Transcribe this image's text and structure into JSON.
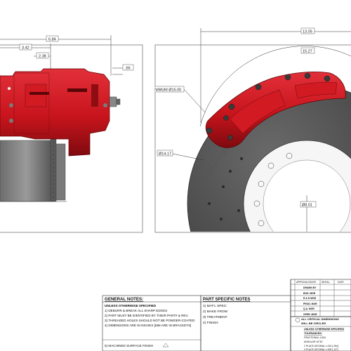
{
  "left_view": {
    "dim_top": "6.84",
    "dim_mid": "3.42",
    "dim_low": "2.38",
    "dim_bolt": ".66"
  },
  "right_view": {
    "dim_overall": "13.05",
    "dim_arc": "15.27",
    "dim_min_label": "MINIMUM Ø16.00",
    "dim_rotor": "Ø14.17",
    "dim_hub": "Ø8.01"
  },
  "general_notes": {
    "title": "GENERAL NOTES:",
    "subtitle": "UNLESS OTHERWISE SPECIFIED",
    "items": [
      "1) DEBURR & BREAK ALL SHARP EDGES",
      "2) PART MUST BE IDENTIFIED BY THEIR PART# & REV.",
      "3) THREADED HOLES SHOULD NOT BE POWDER-COATED",
      "4) DIMENSIONS ARE IN INCHES [MM ARE IN BRACKETS]",
      "5) MACHINED SURFACE FINISH"
    ]
  },
  "part_notes": {
    "title": "PART SPECIFIC NOTES",
    "items": [
      "1) MAT'L SPEC:",
      "2) MAKE FROM:",
      "3) TREATMENT:",
      "4) FINISH:"
    ]
  },
  "title_block": {
    "header_a": "APPROVALS/DATE",
    "header_b": "INITIAL",
    "header_c": "DATE",
    "rows": [
      "DRAWN BY",
      "ENG. MGR",
      "R & D MGR",
      "PROD. MGR",
      "Q.A. MGR",
      "OPER. MGR"
    ],
    "critical_1": "ALL CRITICAL DIMENSIONS",
    "critical_2": "WILL BE CIRCLED",
    "tol_title": "UNLESS OTHERWISE SPECIFIED",
    "tol_sub": "TOLERANCES:",
    "tol_items": [
      "FRACTIONAL ±1/64",
      "ANGULAR ±0°30'",
      "2 PLACE DECIMAL ±.010 [.254]",
      "3 PLACE DECIMAL ±.005 [.127]"
    ]
  },
  "colors": {
    "caliper": "#c8141c",
    "caliper_dark": "#7e0a0f",
    "rotor": "#4a4a4a",
    "hub": "#f4f4f4"
  }
}
